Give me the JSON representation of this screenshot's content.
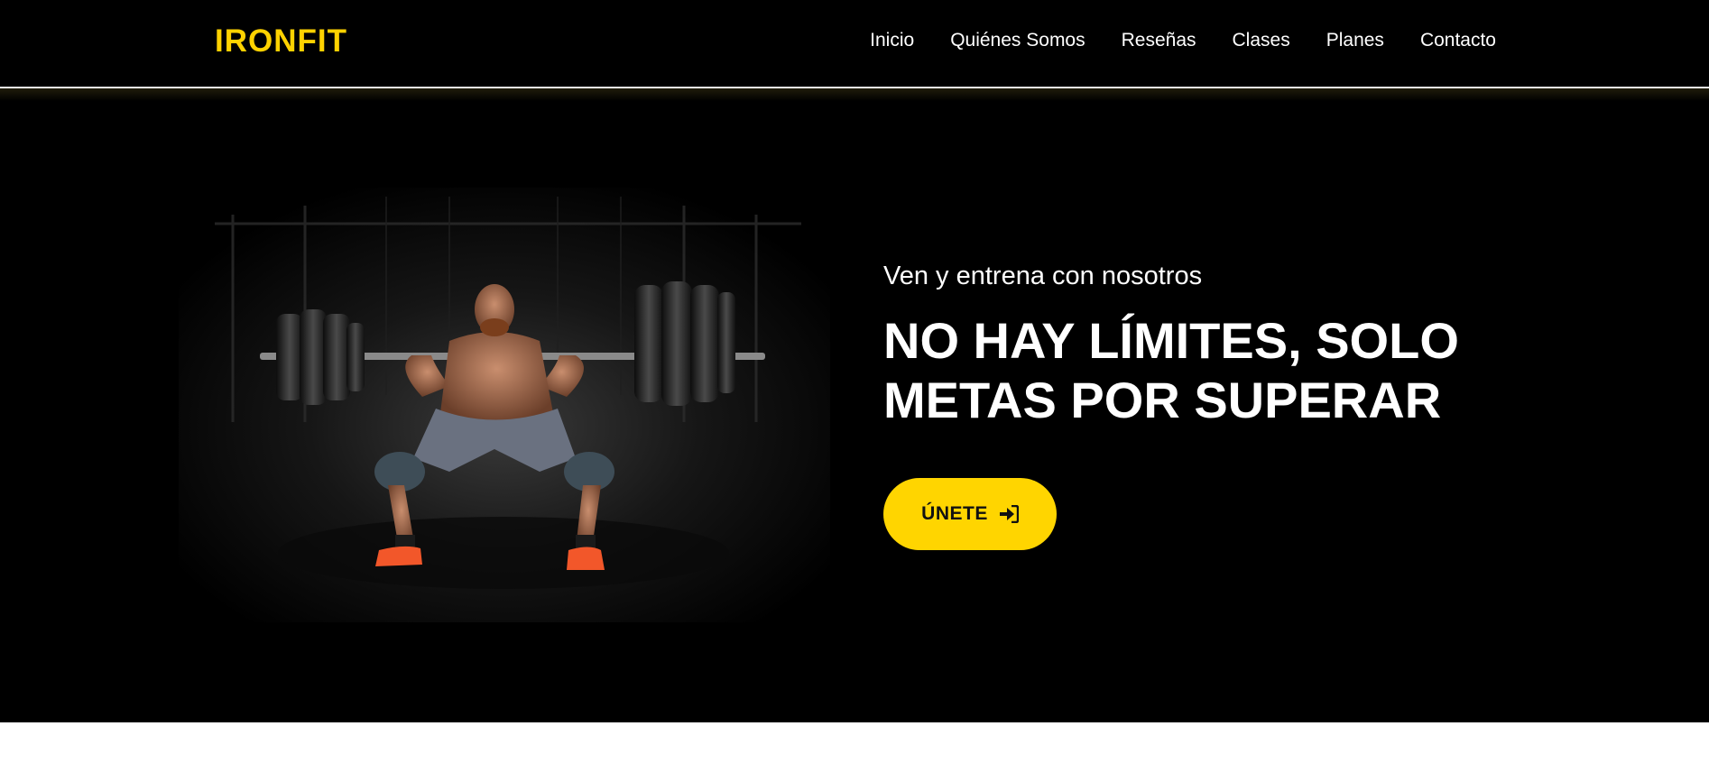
{
  "header": {
    "brand": "IRONFIT",
    "nav": [
      {
        "label": "Inicio"
      },
      {
        "label": "Quiénes Somos"
      },
      {
        "label": "Reseñas"
      },
      {
        "label": "Clases"
      },
      {
        "label": "Planes"
      },
      {
        "label": "Contacto"
      }
    ]
  },
  "hero": {
    "subtitle": "Ven y entrena con nosotros",
    "headline_line1": "NO HAY LÍMITES, SOLO",
    "headline_line2": "METAS POR SUPERAR",
    "cta_label": "ÚNETE",
    "cta_icon": "sign-in-icon"
  },
  "colors": {
    "accent": "#ffd500",
    "background": "#000000",
    "text": "#ffffff"
  }
}
